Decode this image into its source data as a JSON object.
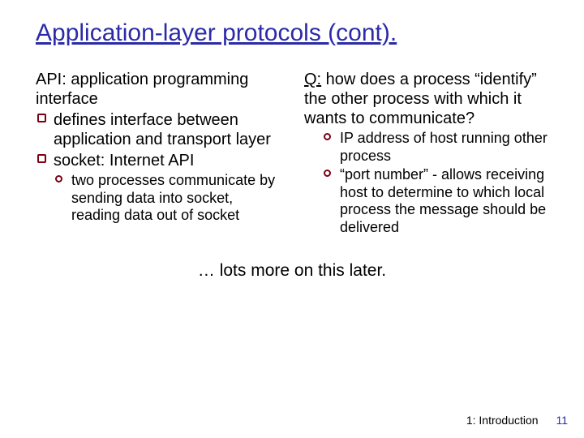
{
  "title": "Application-layer protocols (cont).",
  "left": {
    "api_def": "API: application programming interface",
    "defines": "defines interface between application and transport layer",
    "socket": "socket: Internet API",
    "two_proc": "two processes communicate by sending data into socket, reading data out of socket"
  },
  "right": {
    "q_label": "Q:",
    "q_rest": " how does a process “identify” the other process with which it wants to communicate?",
    "ip": "IP address of host running other process",
    "port": "“port number” - allows receiving host to determine to which local process the message should be delivered"
  },
  "closing": "… lots more on this later.",
  "footer": {
    "chapter": "1: Introduction",
    "page": "11"
  }
}
